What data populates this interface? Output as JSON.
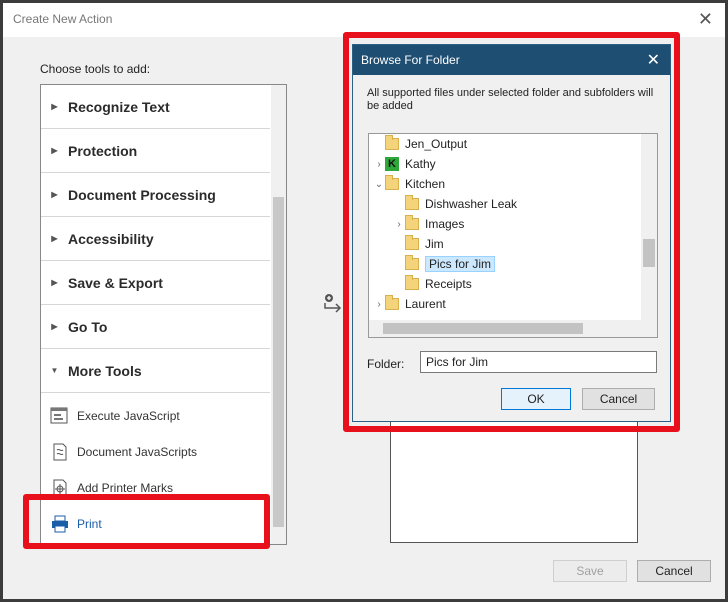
{
  "window": {
    "title": "Create New Action",
    "close": "✕"
  },
  "tools": {
    "heading": "Choose tools to add:",
    "categories": [
      {
        "label": "Recognize Text",
        "arrow": "▶"
      },
      {
        "label": "Protection",
        "arrow": "▶"
      },
      {
        "label": "Document Processing",
        "arrow": "▶"
      },
      {
        "label": "Accessibility",
        "arrow": "▶"
      },
      {
        "label": "Save & Export",
        "arrow": "▶"
      },
      {
        "label": "Go To",
        "arrow": "▶"
      },
      {
        "label": "More Tools",
        "arrow": "▼"
      }
    ],
    "items": [
      {
        "label": "Execute JavaScript",
        "icon": "javascript-window-icon"
      },
      {
        "label": "Document JavaScripts",
        "icon": "document-script-icon"
      },
      {
        "label": "Add Printer Marks",
        "icon": "printer-marks-icon"
      },
      {
        "label": "Print",
        "icon": "printer-icon"
      }
    ]
  },
  "footer": {
    "save": "Save",
    "cancel": "Cancel"
  },
  "browse": {
    "title": "Browse For Folder",
    "close": "✕",
    "description": "All supported files under selected folder and subfolders will be added",
    "tree": [
      {
        "label": "Jen_Output",
        "expander": "",
        "icon": "folder"
      },
      {
        "label": "Kathy",
        "expander": "›",
        "icon": "k"
      },
      {
        "label": "Kitchen",
        "expander": "⌄",
        "icon": "folder"
      },
      {
        "label": "Dishwasher Leak",
        "expander": "",
        "icon": "folder"
      },
      {
        "label": "Images",
        "expander": "›",
        "icon": "folder"
      },
      {
        "label": "Jim",
        "expander": "",
        "icon": "folder"
      },
      {
        "label": "Pics for Jim",
        "expander": "",
        "icon": "folder",
        "selected": true
      },
      {
        "label": "Receipts",
        "expander": "",
        "icon": "folder"
      },
      {
        "label": "Laurent",
        "expander": "›",
        "icon": "folder"
      }
    ],
    "folder_label": "Folder:",
    "folder_value": "Pics for Jim",
    "ok": "OK",
    "cancel": "Cancel"
  },
  "colors": {
    "highlight": "#e8101a",
    "titlebar": "#1f4e73",
    "selection": "#cce8ff"
  }
}
